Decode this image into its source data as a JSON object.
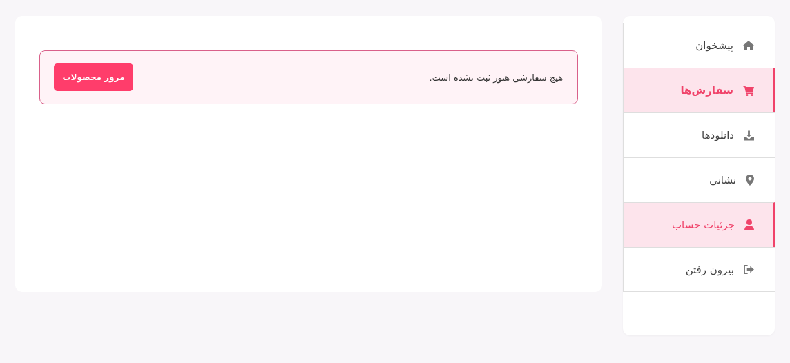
{
  "menu": [
    {
      "label": "پیشخوان",
      "kind": "home",
      "selected": false,
      "hovered": false
    },
    {
      "label": "سفارش‌ها",
      "kind": "cart",
      "selected": true,
      "hovered": false
    },
    {
      "label": "دانلودها",
      "kind": "download",
      "selected": false,
      "hovered": false
    },
    {
      "label": "نشانی",
      "kind": "pin",
      "selected": false,
      "hovered": false
    },
    {
      "label": "جزئیات حساب",
      "kind": "user",
      "selected": false,
      "hovered": true
    },
    {
      "label": "بیرون رفتن",
      "kind": "logout",
      "selected": false,
      "hovered": false
    }
  ],
  "notice": {
    "message": "هیچ سفارشی هنوز ثبت نشده است.",
    "button": "مرور محصولات"
  }
}
